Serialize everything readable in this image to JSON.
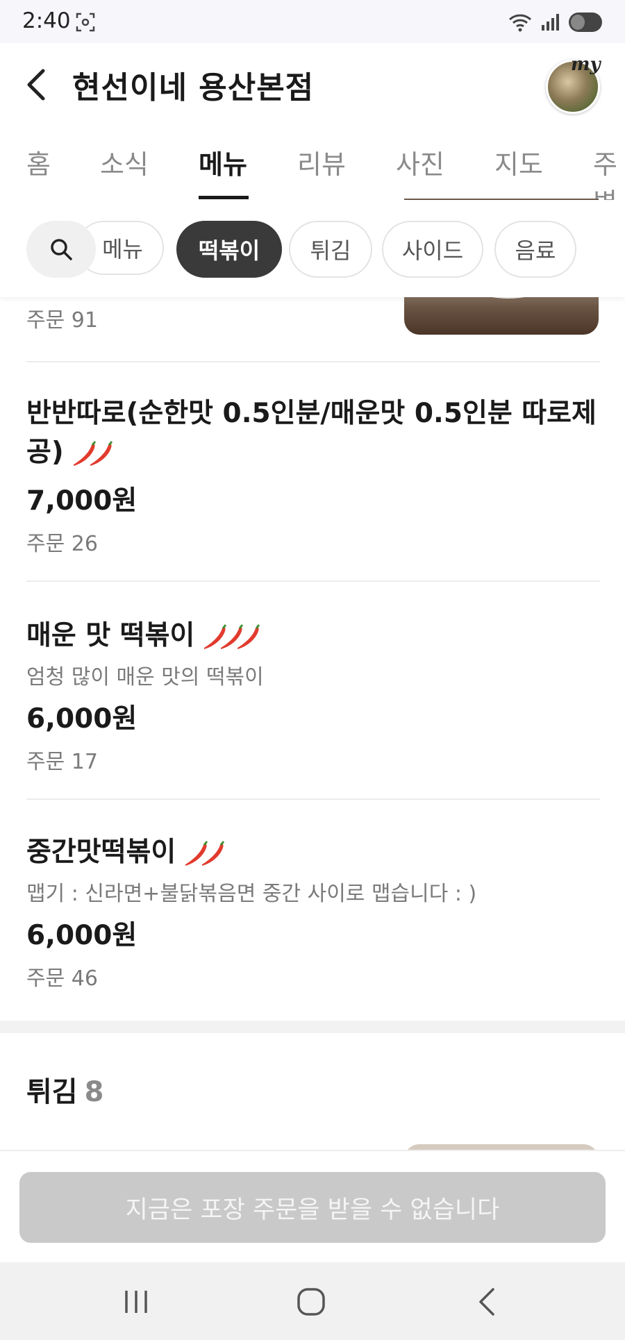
{
  "status_bar": {
    "time": "2:40"
  },
  "header": {
    "store_name": "현선이네 용산본점",
    "avatar_badge": "my"
  },
  "tabs": [
    {
      "label": "홈"
    },
    {
      "label": "소식"
    },
    {
      "label": "메뉴",
      "active": true
    },
    {
      "label": "리뷰"
    },
    {
      "label": "사진"
    },
    {
      "label": "지도"
    },
    {
      "label": "주변"
    }
  ],
  "category_chips": [
    {
      "label": "메뉴"
    },
    {
      "label": "떡볶이",
      "active": true
    },
    {
      "label": "튀김"
    },
    {
      "label": "사이드"
    },
    {
      "label": "음료"
    }
  ],
  "previous_item": {
    "orders": "주문 91"
  },
  "menu_items": [
    {
      "name": "반반따로(순한맛 0.5인분/매운맛 0.5인분 따로제공)",
      "spice_level": 2,
      "price": "7,000원",
      "orders": "주문 26"
    },
    {
      "name": "매운 맛 떡볶이",
      "spice_level": 3,
      "description": "엄청 많이 매운 맛의 떡볶이",
      "price": "6,000원",
      "orders": "주문 17"
    },
    {
      "name": "중간맛떡볶이",
      "spice_level": 2,
      "description": "맵기 : 신라면+불닭볶음면 중간 사이로 맵습니다 : )",
      "price": "6,000원",
      "orders": "주문 46"
    }
  ],
  "next_section": {
    "title": "튀김",
    "count": "8"
  },
  "order_button": {
    "label": "지금은 포장 주문을 받을 수 없습니다"
  },
  "colors": {
    "accent": "#3a3a3a",
    "disabled_button": "#c9c9c9",
    "pepper": "#e23b2e"
  }
}
